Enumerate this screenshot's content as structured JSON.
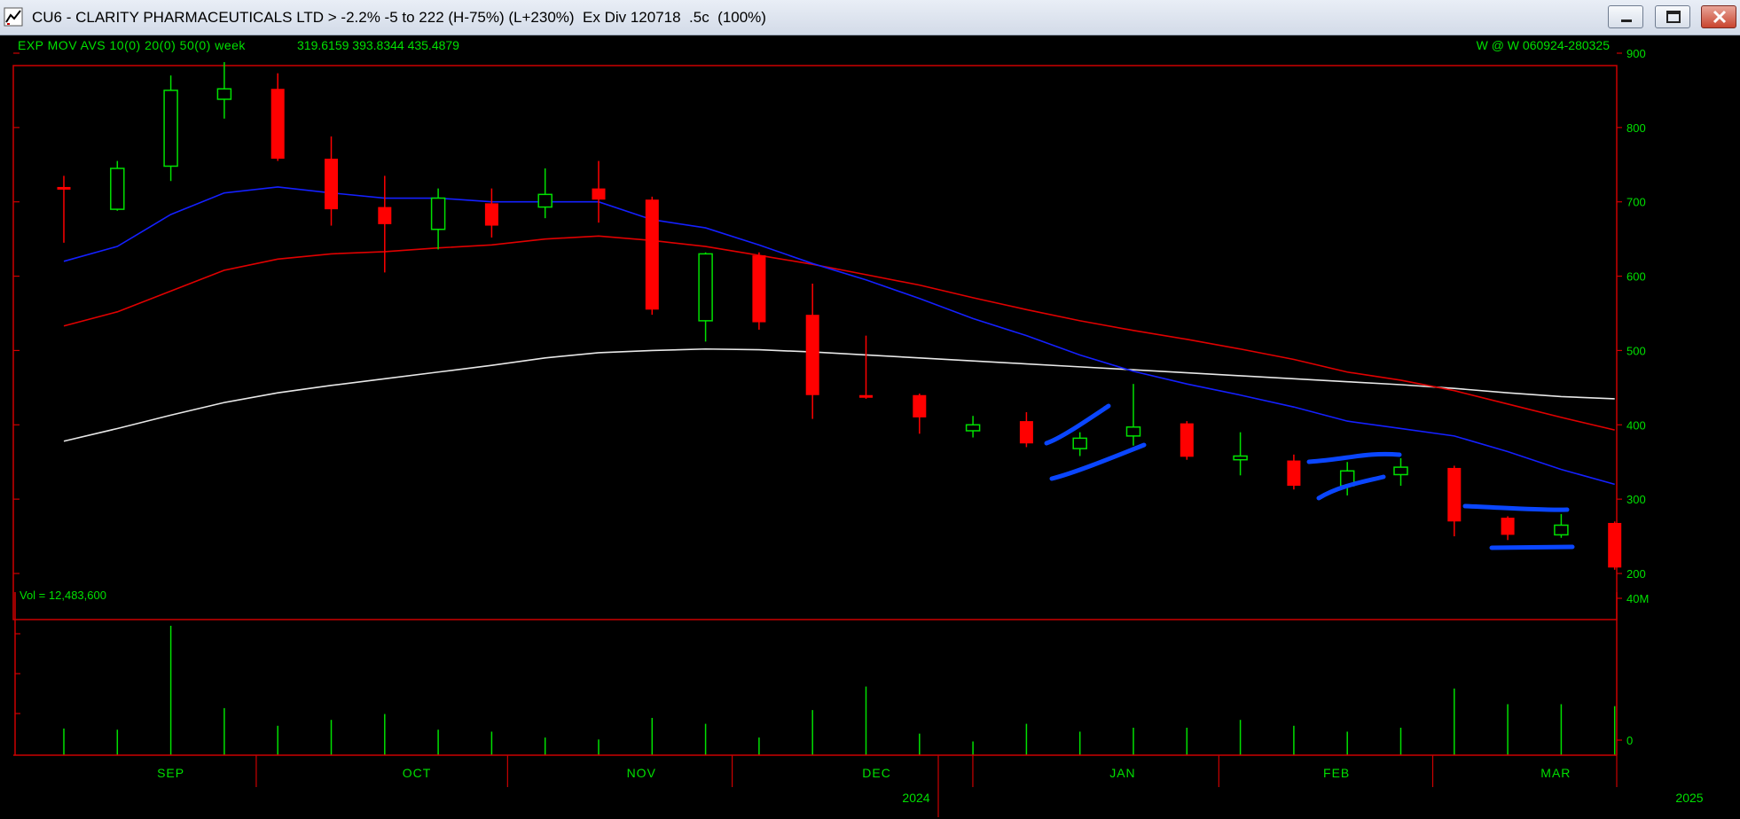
{
  "window": {
    "title": "CU6 - CLARITY PHARMACEUTICALS LTD > -2.2% -5 to 222 (H-75%) (L+230%)  Ex Div 120718  .5c  (100%)"
  },
  "chart_header": {
    "indicator_label": "EXP MOV AVS 10(0) 20(0) 50(0)  week",
    "indicator_values": "319.6159  393.8344  435.4879",
    "right_label": "W @ W   060924-280325"
  },
  "volume_label": "Vol = 12,483,600",
  "chart_data": {
    "type": "candlestick",
    "interval": "week",
    "price_axis": {
      "ticks": [
        900,
        800,
        700,
        600,
        500,
        400,
        300,
        200
      ],
      "range": [
        190,
        915
      ]
    },
    "volume_axis": {
      "ticks": [
        "40M",
        "0"
      ],
      "max_millions": 40
    },
    "months": [
      "SEP",
      "OCT",
      "NOV",
      "DEC",
      "JAN",
      "FEB",
      "MAR"
    ],
    "year_labels": [
      "2024",
      "2025"
    ],
    "candles": [
      {
        "o": 720,
        "h": 735,
        "l": 645,
        "c": 718,
        "v": 6.8
      },
      {
        "o": 690,
        "h": 755,
        "l": 688,
        "c": 745,
        "v": 6.5
      },
      {
        "o": 748,
        "h": 870,
        "l": 728,
        "c": 850,
        "v": 33
      },
      {
        "o": 838,
        "h": 888,
        "l": 812,
        "c": 852,
        "v": 12
      },
      {
        "o": 852,
        "h": 873,
        "l": 755,
        "c": 758,
        "v": 7.5
      },
      {
        "o": 758,
        "h": 788,
        "l": 668,
        "c": 690,
        "v": 9
      },
      {
        "o": 693,
        "h": 735,
        "l": 605,
        "c": 670,
        "v": 10.5
      },
      {
        "o": 663,
        "h": 718,
        "l": 636,
        "c": 705,
        "v": 6.5
      },
      {
        "o": 698,
        "h": 718,
        "l": 652,
        "c": 668,
        "v": 6
      },
      {
        "o": 693,
        "h": 745,
        "l": 678,
        "c": 710,
        "v": 4.5
      },
      {
        "o": 718,
        "h": 755,
        "l": 672,
        "c": 703,
        "v": 4
      },
      {
        "o": 703,
        "h": 707,
        "l": 548,
        "c": 555,
        "v": 9.5
      },
      {
        "o": 540,
        "h": 632,
        "l": 512,
        "c": 630,
        "v": 8
      },
      {
        "o": 628,
        "h": 632,
        "l": 528,
        "c": 538,
        "v": 4.5
      },
      {
        "o": 548,
        "h": 590,
        "l": 408,
        "c": 440,
        "v": 11.5
      },
      {
        "o": 440,
        "h": 520,
        "l": 435,
        "c": 437,
        "v": 17.5
      },
      {
        "o": 440,
        "h": 442,
        "l": 388,
        "c": 410,
        "v": 5.5
      },
      {
        "o": 392,
        "h": 412,
        "l": 383,
        "c": 400,
        "v": 3.5
      },
      {
        "o": 405,
        "h": 417,
        "l": 370,
        "c": 375,
        "v": 8
      },
      {
        "o": 368,
        "h": 390,
        "l": 358,
        "c": 382,
        "v": 6
      },
      {
        "o": 385,
        "h": 455,
        "l": 372,
        "c": 397,
        "v": 7
      },
      {
        "o": 402,
        "h": 405,
        "l": 353,
        "c": 357,
        "v": 7
      },
      {
        "o": 353,
        "h": 390,
        "l": 332,
        "c": 358,
        "v": 9
      },
      {
        "o": 352,
        "h": 360,
        "l": 313,
        "c": 318,
        "v": 7.5
      },
      {
        "o": 318,
        "h": 350,
        "l": 305,
        "c": 338,
        "v": 6
      },
      {
        "o": 333,
        "h": 355,
        "l": 318,
        "c": 343,
        "v": 7
      },
      {
        "o": 342,
        "h": 345,
        "l": 250,
        "c": 270,
        "v": 17
      },
      {
        "o": 275,
        "h": 277,
        "l": 245,
        "c": 252,
        "v": 13
      },
      {
        "o": 252,
        "h": 280,
        "l": 248,
        "c": 265,
        "v": 13
      },
      {
        "o": 268,
        "h": 270,
        "l": 205,
        "c": 208,
        "v": 12.5
      }
    ],
    "ema10": [
      620,
      640,
      683,
      712,
      720,
      712,
      705,
      705,
      700,
      700,
      700,
      676,
      665,
      642,
      617,
      595,
      570,
      543,
      520,
      494,
      472,
      455,
      440,
      424,
      405,
      395,
      385,
      364,
      340,
      320
    ],
    "ema20": [
      533,
      552,
      580,
      608,
      623,
      630,
      633,
      638,
      642,
      650,
      654,
      648,
      640,
      628,
      616,
      602,
      588,
      571,
      555,
      540,
      527,
      515,
      502,
      488,
      471,
      460,
      446,
      428,
      410,
      393
    ],
    "ema50": [
      378,
      395,
      413,
      430,
      443,
      453,
      462,
      471,
      480,
      490,
      497,
      500,
      502,
      501,
      498,
      494,
      490,
      486,
      482,
      478,
      474,
      470,
      466,
      462,
      458,
      454,
      449,
      443,
      438,
      435
    ]
  },
  "colors": {
    "up": "#00e000",
    "down": "#ff0000",
    "ema10": "#1420ff",
    "ema20": "#e00000",
    "ema50": "#e8e8e8",
    "frame": "#cc0000",
    "text": "#00e000",
    "annotation": "#0a46ff"
  }
}
